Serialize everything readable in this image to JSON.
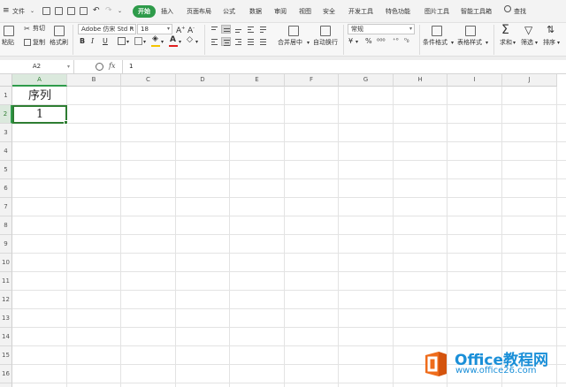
{
  "menubar": {
    "file_label": "文件",
    "tabs": [
      {
        "label": "开始",
        "active": true
      },
      {
        "label": "插入"
      },
      {
        "label": "页面布局"
      },
      {
        "label": "公式"
      },
      {
        "label": "数据"
      },
      {
        "label": "审阅"
      },
      {
        "label": "视图"
      },
      {
        "label": "安全"
      },
      {
        "label": "开发工具"
      },
      {
        "label": "特色功能"
      },
      {
        "label": "图片工具"
      },
      {
        "label": "智能工具箱"
      }
    ],
    "search_label": "查找",
    "accent_color": "#2e9b4a"
  },
  "ribbon": {
    "paste": "粘贴",
    "cut": "剪切",
    "copy": "复制",
    "format_painter": "格式刷",
    "font_name": "Adobe 仿宋 Std R",
    "font_size": "18",
    "font_color_swatch": "#e02020",
    "fill_color_swatch": "#f5c400",
    "merge_center": "合并居中",
    "wrap_text": "自动换行",
    "number_format": "常规",
    "conditional_format": "条件格式",
    "table_style": "表格样式",
    "sum": "求和",
    "filter": "筛选",
    "sort": "排序"
  },
  "formula_bar": {
    "name_box": "A2",
    "fx_label": "fx",
    "value": "1"
  },
  "sheet": {
    "columns": [
      "A",
      "B",
      "C",
      "D",
      "E",
      "F",
      "G",
      "H",
      "I",
      "J"
    ],
    "rows": [
      "1",
      "2",
      "3",
      "4",
      "5",
      "6",
      "7",
      "8",
      "9",
      "10",
      "11",
      "12",
      "13",
      "14",
      "15",
      "16",
      "17"
    ],
    "cells": {
      "A1": "序列",
      "A2": "1"
    },
    "selected_cell": "A2",
    "selection_color": "#2e7d32"
  },
  "watermark": {
    "title": "Office教程网",
    "url": "www.office26.com",
    "logo_color": "#ef6c1b"
  }
}
